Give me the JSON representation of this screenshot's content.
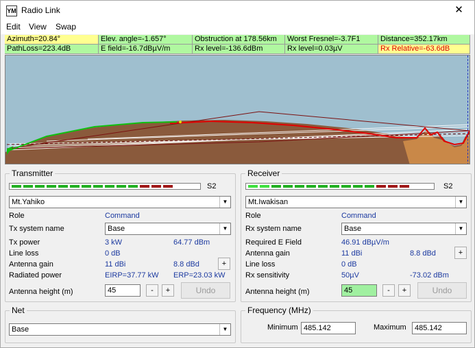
{
  "window": {
    "title": "Radio Link",
    "icon_text": "YM",
    "close_glyph": "✕"
  },
  "menu": [
    "Edit",
    "View",
    "Swap"
  ],
  "info": {
    "azimuth": "Azimuth=20.84°",
    "elev_angle": "Elev. angle=-1.657°",
    "obstruction": "Obstruction at 178.56km",
    "worst_fresnel": "Worst Fresnel=-3.7F1",
    "distance": "Distance=352.17km",
    "path_loss": "PathLoss=223.4dB",
    "e_field": "E field=-16.7dBµV/m",
    "rx_level_dbm": "Rx level=-136.6dBm",
    "rx_level_uv": "Rx level=0.03µV",
    "rx_relative": "Rx Relative=-63.6dB"
  },
  "transmitter": {
    "title": "Transmitter",
    "meter_label": "S2",
    "site": "Mt.Yahiko",
    "role_label": "Role",
    "role_value": "Command",
    "system_label": "Tx system name",
    "system_value": "Base",
    "power_label": "Tx power",
    "power_kw": "3 kW",
    "power_dbm": "64.77 dBm",
    "line_loss_label": "Line loss",
    "line_loss_value": "0 dB",
    "gain_label": "Antenna gain",
    "gain_dbi": "11 dBi",
    "gain_dbd": "8.8 dBd",
    "radiated_label": "Radiated power",
    "eirp": "EIRP=37.77 kW",
    "erp": "ERP=23.03 kW",
    "height_label": "Antenna height (m)",
    "height_value": "45",
    "minus": "-",
    "plus": "+",
    "undo": "Undo"
  },
  "receiver": {
    "title": "Receiver",
    "meter_label": "S2",
    "site": "Mt.Iwakisan",
    "role_label": "Role",
    "role_value": "Command",
    "system_label": "Rx system name",
    "system_value": "Base",
    "req_field_label": "Required E Field",
    "req_field_value": "46.91 dBµV/m",
    "gain_label": "Antenna gain",
    "gain_dbi": "11 dBi",
    "gain_dbd": "8.8 dBd",
    "line_loss_label": "Line loss",
    "line_loss_value": "0 dB",
    "sens_label": "Rx sensitivity",
    "sens_uv": "50µV",
    "sens_dbm": "-73.02 dBm",
    "height_label": "Antenna height (m)",
    "height_value": "45",
    "minus": "-",
    "plus": "+",
    "undo": "Undo"
  },
  "net": {
    "title": "Net",
    "value": "Base"
  },
  "frequency": {
    "title": "Frequency (MHz)",
    "min_label": "Minimum",
    "min_value": "485.142",
    "max_label": "Maximum",
    "max_value": "485.142"
  },
  "colors": {
    "info_green": "#b0f8a0",
    "info_yellow": "#ffff90",
    "sky": "#9fbfcf",
    "terrain": "#8a5a3c",
    "fresnel": "#e00000",
    "ray": "#00c000"
  }
}
